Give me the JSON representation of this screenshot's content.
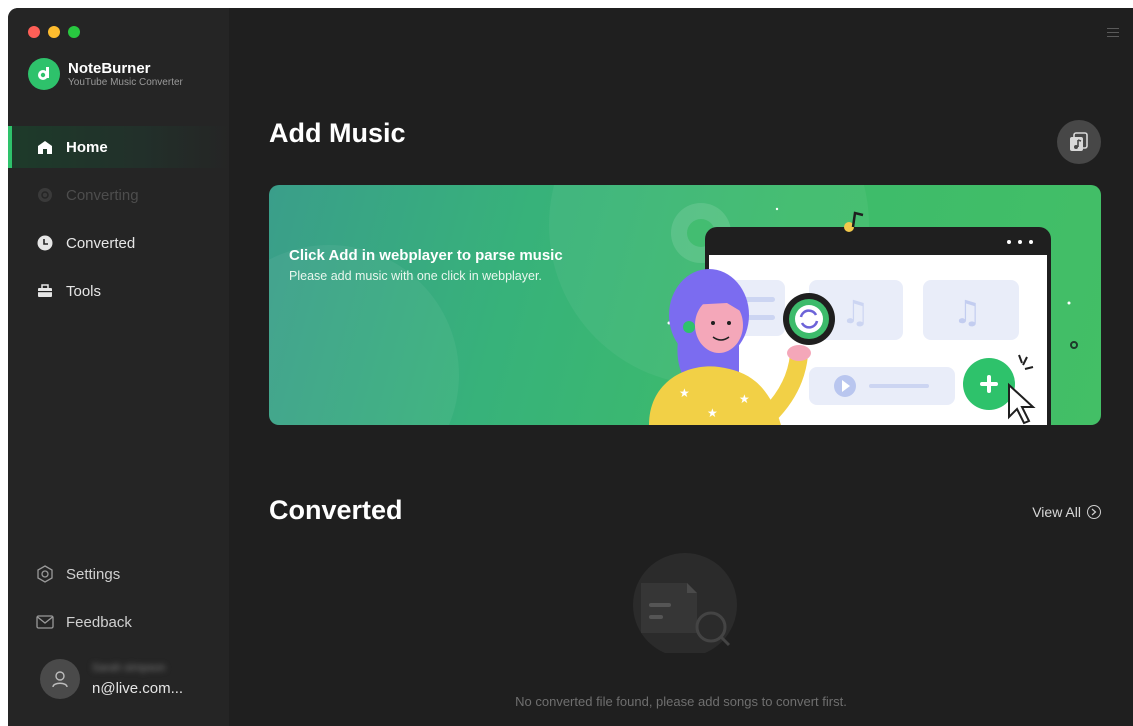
{
  "app": {
    "name": "NoteBurner",
    "subtitle": "YouTube Music Converter"
  },
  "sidebar": {
    "items": [
      {
        "label": "Home",
        "icon": "home-icon",
        "state": "active"
      },
      {
        "label": "Converting",
        "icon": "converting-icon",
        "state": "disabled"
      },
      {
        "label": "Converted",
        "icon": "clock-icon",
        "state": "normal"
      },
      {
        "label": "Tools",
        "icon": "toolbox-icon",
        "state": "normal"
      }
    ],
    "bottom_items": [
      {
        "label": "Settings",
        "icon": "gear-icon"
      },
      {
        "label": "Feedback",
        "icon": "mail-icon"
      }
    ],
    "user": {
      "name": "Sarah simpson",
      "email": "n@live.com..."
    }
  },
  "main": {
    "add_music_title": "Add Music",
    "banner": {
      "title": "Click Add in webplayer to parse music",
      "subtitle": "Please add music with one click in webplayer."
    },
    "converted_title": "Converted",
    "view_all": "View All",
    "empty_text": "No converted file found, please add songs to convert first."
  },
  "colors": {
    "accent": "#2ec26b",
    "background": "#1f1f1f",
    "sidebar": "#252525"
  }
}
